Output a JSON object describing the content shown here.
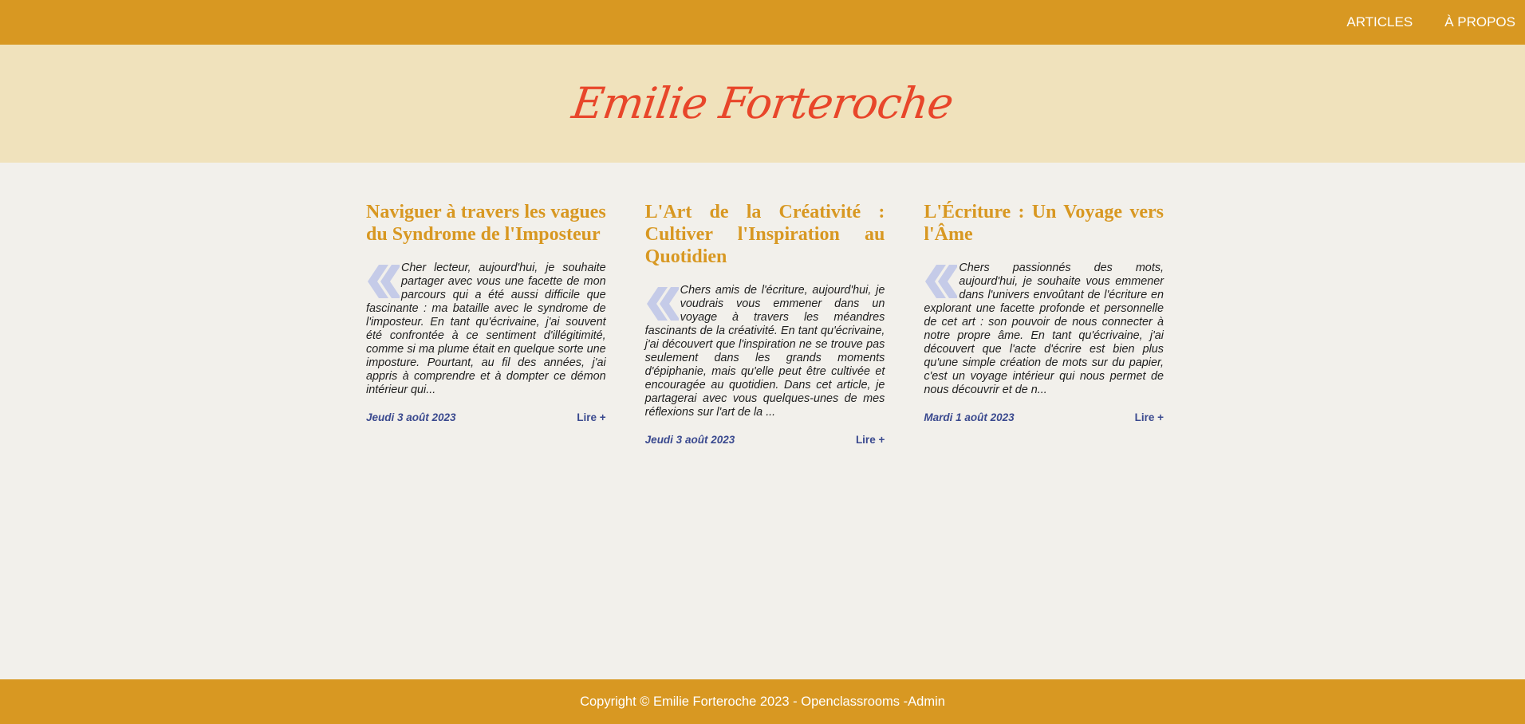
{
  "nav": {
    "items": [
      {
        "label": "ARTICLES"
      },
      {
        "label": "À PROPOS"
      }
    ]
  },
  "site": {
    "title": "Emilie Forteroche"
  },
  "articles": [
    {
      "title": "Naviguer à travers les vagues du Syndrome de l'Imposteur",
      "excerpt": "Cher lecteur, aujourd'hui, je souhaite partager avec vous une facette de mon parcours qui a été aussi difficile que fascinante : ma bataille avec le syndrome de l'imposteur. En tant qu'écrivaine, j'ai souvent été confrontée à ce sentiment d'illégitimité, comme si ma plume était en quelque sorte une imposture. Pourtant, au fil des années, j'ai appris à comprendre et à dompter ce démon intérieur qui...",
      "date": "Jeudi 3 août 2023",
      "more": "Lire +"
    },
    {
      "title": "L'Art de la Créativité : Cultiver l'Inspiration au Quotidien",
      "excerpt": "Chers amis de l'écriture, aujourd'hui, je voudrais vous emmener dans un voyage à travers les méandres fascinants de la créativité. En tant qu'écrivaine, j'ai découvert que l'inspiration ne se trouve pas seulement dans les grands moments d'épiphanie, mais qu'elle peut être cultivée et encouragée au quotidien. Dans cet article, je partagerai avec vous quelques-unes de mes réflexions sur l'art de la ...",
      "date": "Jeudi 3 août 2023",
      "more": "Lire +"
    },
    {
      "title": "L'Écriture : Un Voyage vers l'Âme",
      "excerpt": "Chers passionnés des mots, aujourd'hui, je souhaite vous emmener dans l'univers envoûtant de l'écriture en explorant une facette profonde et personnelle de cet art : son pouvoir de nous connecter à notre propre âme. En tant qu'écrivaine, j'ai découvert que l'acte d'écrire est bien plus qu'une simple création de mots sur du papier, c'est un voyage intérieur qui nous permet de nous découvrir et de n...",
      "date": "Mardi 1 août 2023",
      "more": "Lire +"
    }
  ],
  "footer": {
    "text": "Copyright © Emilie Forteroche 2023 - Openclassrooms - ",
    "admin": "Admin"
  },
  "colors": {
    "primary": "#d89822",
    "hero_bg": "#f0e2bc",
    "page_bg": "#f2f0eb",
    "brand": "#e8462a",
    "link": "#3b4a8f",
    "quote": "#c5cbe8"
  },
  "icons": {
    "quote": "left-double-angle-quote-icon"
  }
}
